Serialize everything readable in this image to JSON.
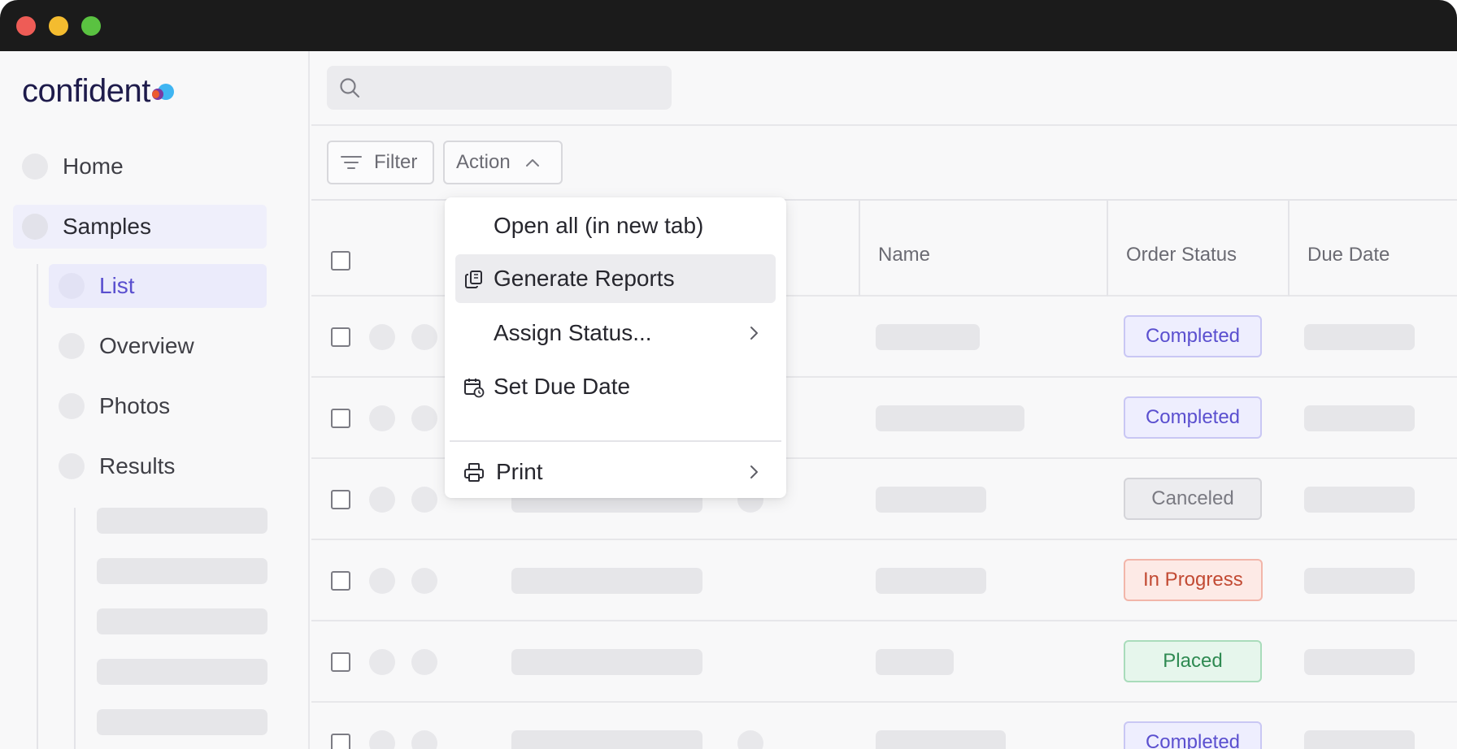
{
  "window": {
    "traffic_lights": [
      "close",
      "minimize",
      "zoom"
    ]
  },
  "brand": {
    "logo_text": "confident"
  },
  "sidebar": {
    "items": [
      {
        "label": "Home"
      },
      {
        "label": "Samples",
        "selected": true
      },
      {
        "label": "List",
        "active": true
      },
      {
        "label": "Overview"
      },
      {
        "label": "Photos"
      },
      {
        "label": "Results"
      }
    ]
  },
  "search": {
    "placeholder": ""
  },
  "toolbar": {
    "filter_label": "Filter",
    "action_label": "Action"
  },
  "action_menu": {
    "items": [
      {
        "label": "Open all (in new tab)"
      },
      {
        "label": "Generate Reports",
        "icon": "copy-icon",
        "highlighted": true
      },
      {
        "label": "Assign Status...",
        "submenu": true
      },
      {
        "label": "Set Due Date",
        "icon": "calendar-clock-icon"
      },
      {
        "label": "Print",
        "icon": "printer-icon",
        "submenu": true
      }
    ]
  },
  "table": {
    "columns": [
      "Name",
      "Order Status",
      "Due Date"
    ],
    "rows": [
      {
        "status": "Completed"
      },
      {
        "status": "Completed"
      },
      {
        "status": "Canceled"
      },
      {
        "status": "In Progress"
      },
      {
        "status": "Placed"
      },
      {
        "status": "Completed"
      }
    ]
  },
  "colors": {
    "accent": "#5a4fcf",
    "completed": "#5a4fcf",
    "canceled": "#7a7a82",
    "in_progress": "#c24a33",
    "placed": "#2f8a52"
  }
}
